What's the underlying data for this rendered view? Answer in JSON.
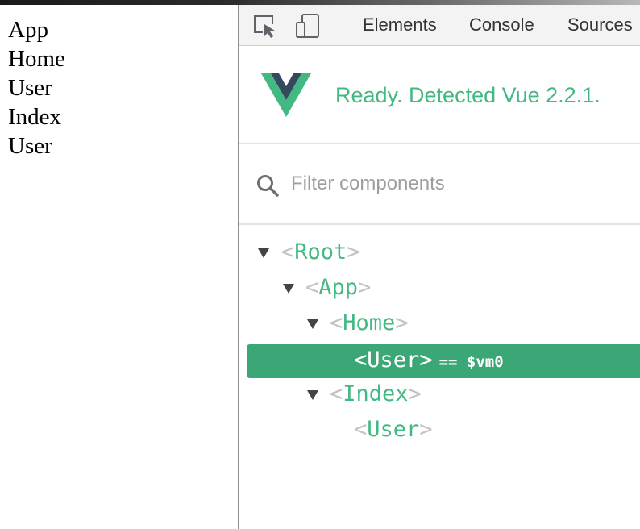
{
  "page": {
    "lines": [
      "App",
      "Home",
      "User",
      "Index",
      "User"
    ]
  },
  "devtools": {
    "tabs": [
      "Elements",
      "Console",
      "Sources"
    ],
    "vue_status": "Ready. Detected Vue 2.2.1.",
    "search": {
      "placeholder": "Filter components",
      "value": ""
    },
    "tree": [
      {
        "name": "Root",
        "expanded": true,
        "selected": false,
        "open": "<",
        "close": ">"
      },
      {
        "name": "App",
        "expanded": true,
        "selected": false,
        "open": "<",
        "close": ">"
      },
      {
        "name": "Home",
        "expanded": true,
        "selected": false,
        "open": "<",
        "close": ">"
      },
      {
        "name": "User",
        "expanded": false,
        "selected": true,
        "open": "<",
        "close": ">",
        "vm": "== $vm0"
      },
      {
        "name": "Index",
        "expanded": true,
        "selected": false,
        "open": "<",
        "close": ">"
      },
      {
        "name": "User",
        "expanded": false,
        "selected": false,
        "open": "<",
        "close": ">"
      }
    ]
  },
  "colors": {
    "vue_green": "#42b983",
    "selected_row": "#3ba776",
    "vue_dark": "#35495e"
  },
  "icons": {
    "inspect": "inspect-element-icon",
    "device": "device-toolbar-icon",
    "search": "search-icon",
    "vue_logo": "vue-logo",
    "expand": "expand-arrow-icon"
  }
}
